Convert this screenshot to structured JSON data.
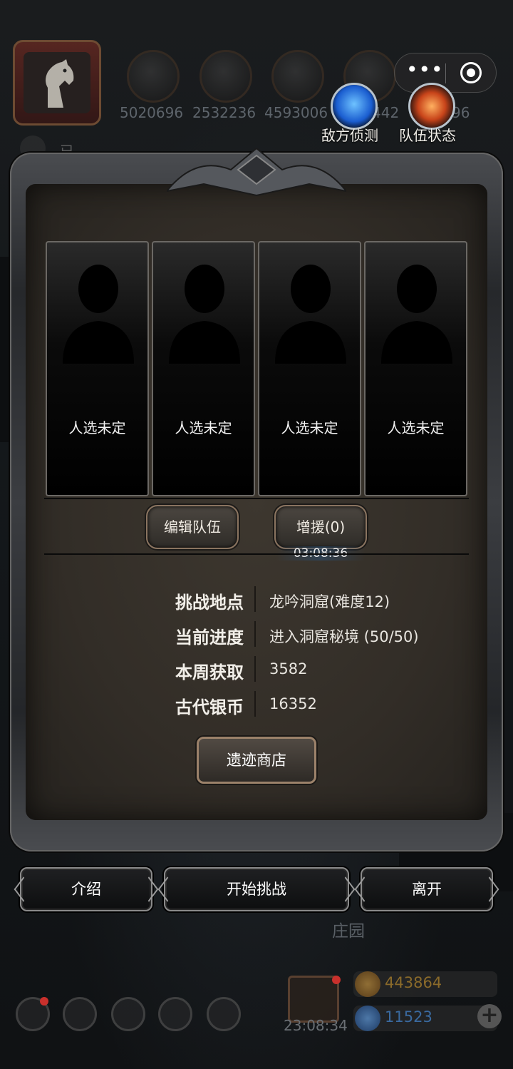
{
  "top_bar": {
    "resources": [
      {
        "icon": "meat-icon",
        "value": "5020696"
      },
      {
        "icon": "wood-icon",
        "value": "2532236"
      },
      {
        "icon": "iron-icon",
        "value": "4593006"
      },
      {
        "icon": "crystal-icon",
        "value": "442"
      },
      {
        "icon": "fire-resource-icon",
        "value": "96"
      }
    ],
    "enemy_scout_label": "敌方侦测",
    "team_status_label": "队伍状态",
    "hidden_label": "已..."
  },
  "team": {
    "slots": [
      {
        "label": "人选未定"
      },
      {
        "label": "人选未定"
      },
      {
        "label": "人选未定"
      },
      {
        "label": "人选未定"
      }
    ],
    "edit_team_label": "编辑队伍",
    "reinforce_label": "增援(0)",
    "timer": "03:08:36"
  },
  "info": {
    "rows": [
      {
        "label": "挑战地点",
        "value": "龙吟洞窟(难度12)"
      },
      {
        "label": "当前进度",
        "value": "进入洞窟秘境 (50/50)"
      },
      {
        "label": "本周获取",
        "value": "3582"
      },
      {
        "label": "古代银币",
        "value": "16352"
      }
    ],
    "shop_label": "遗迹商店"
  },
  "actions": {
    "intro_label": "介绍",
    "start_label": "开始挑战",
    "leave_label": "离开"
  },
  "bottom_bar": {
    "location": "庄园",
    "gift_timer": "23:08:34",
    "gold": "443864",
    "gems": "11523",
    "plus": "+"
  },
  "colors": {
    "panel_bg": "#322d27",
    "accent_gold": "#9c826a",
    "gold_text": "#8a6a2a",
    "gem_text": "#3a6aa0"
  }
}
